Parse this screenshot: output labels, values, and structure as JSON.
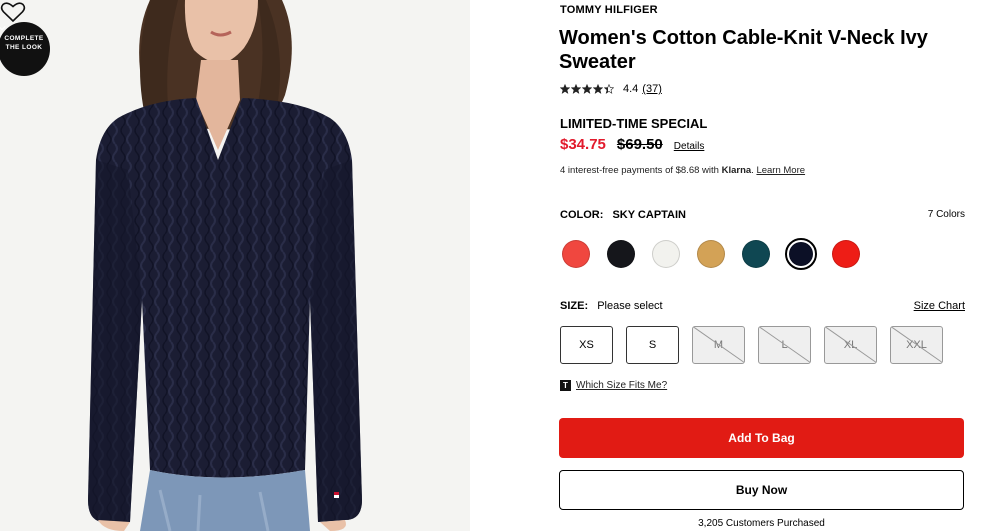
{
  "image": {
    "complete_look_line1": "COMPLETE",
    "complete_look_line2": "THE LOOK",
    "icons": [
      "chevron-down-icon",
      "heart-icon"
    ]
  },
  "product": {
    "brand": "TOMMY HILFIGER",
    "title": "Women's Cotton Cable-Knit V-Neck Ivy Sweater",
    "rating_value": "4.4",
    "rating_stars": 4.4,
    "review_count": "(37)",
    "promo_label": "LIMITED-TIME SPECIAL",
    "sale_price": "$34.75",
    "original_price": "$69.50",
    "details_link": "Details",
    "klarna_prefix": "4 interest-free payments of $8.68 with ",
    "klarna_brand": "Klarna",
    "klarna_suffix": ". ",
    "klarna_link": "Learn More"
  },
  "color": {
    "label": "COLOR:",
    "value": "SKY CAPTAIN",
    "count": "7 Colors",
    "swatches": [
      "#f0473f",
      "#15161b",
      "#f2f2ee",
      "#d3a256",
      "#0f4752",
      "#0c1026",
      "#ee1d16"
    ],
    "selected_index": 5
  },
  "size": {
    "label": "SIZE:",
    "value": "Please select",
    "chart_link": "Size Chart",
    "options": [
      "XS",
      "S",
      "M",
      "L",
      "XL",
      "XXL"
    ],
    "fit_badge": "T",
    "fit_link": "Which Size Fits Me?"
  },
  "actions": {
    "add_to_bag": "Add To Bag",
    "buy_now": "Buy Now",
    "purchased": "3,205 Customers Purchased"
  },
  "colors": {
    "sale_red": "#e21a2c",
    "button_red": "#e11b14",
    "sweater_navy": "#1b1d33"
  }
}
